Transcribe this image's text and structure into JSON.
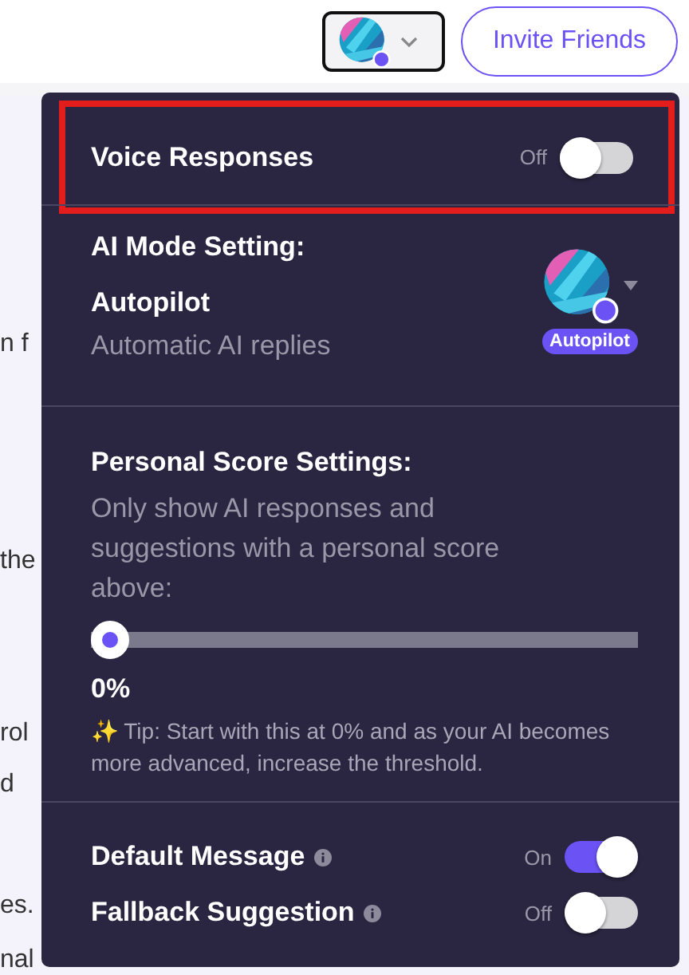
{
  "header": {
    "invite_button": "Invite Friends"
  },
  "background_text": [
    "n f",
    "the",
    "rol",
    "d",
    "es.",
    "nal"
  ],
  "popup": {
    "voice": {
      "label": "Voice Responses",
      "state_label": "Off",
      "on": false,
      "highlighted": true
    },
    "ai_mode": {
      "title": "AI Mode Setting:",
      "mode": "Autopilot",
      "description": "Automatic AI replies",
      "badge": "Autopilot"
    },
    "score": {
      "title": "Personal Score Settings:",
      "description": "Only show AI responses and suggestions with a personal score above:",
      "level": 0,
      "value": "0%",
      "tip_icon": "✨",
      "tip": "Tip: Start with this at 0% and as your AI becomes more advanced, increase the threshold."
    },
    "toggles": [
      {
        "label": "Default Message",
        "state_label": "On",
        "on": true
      },
      {
        "label": "Fallback Suggestion",
        "state_label": "Off",
        "on": false
      }
    ]
  }
}
